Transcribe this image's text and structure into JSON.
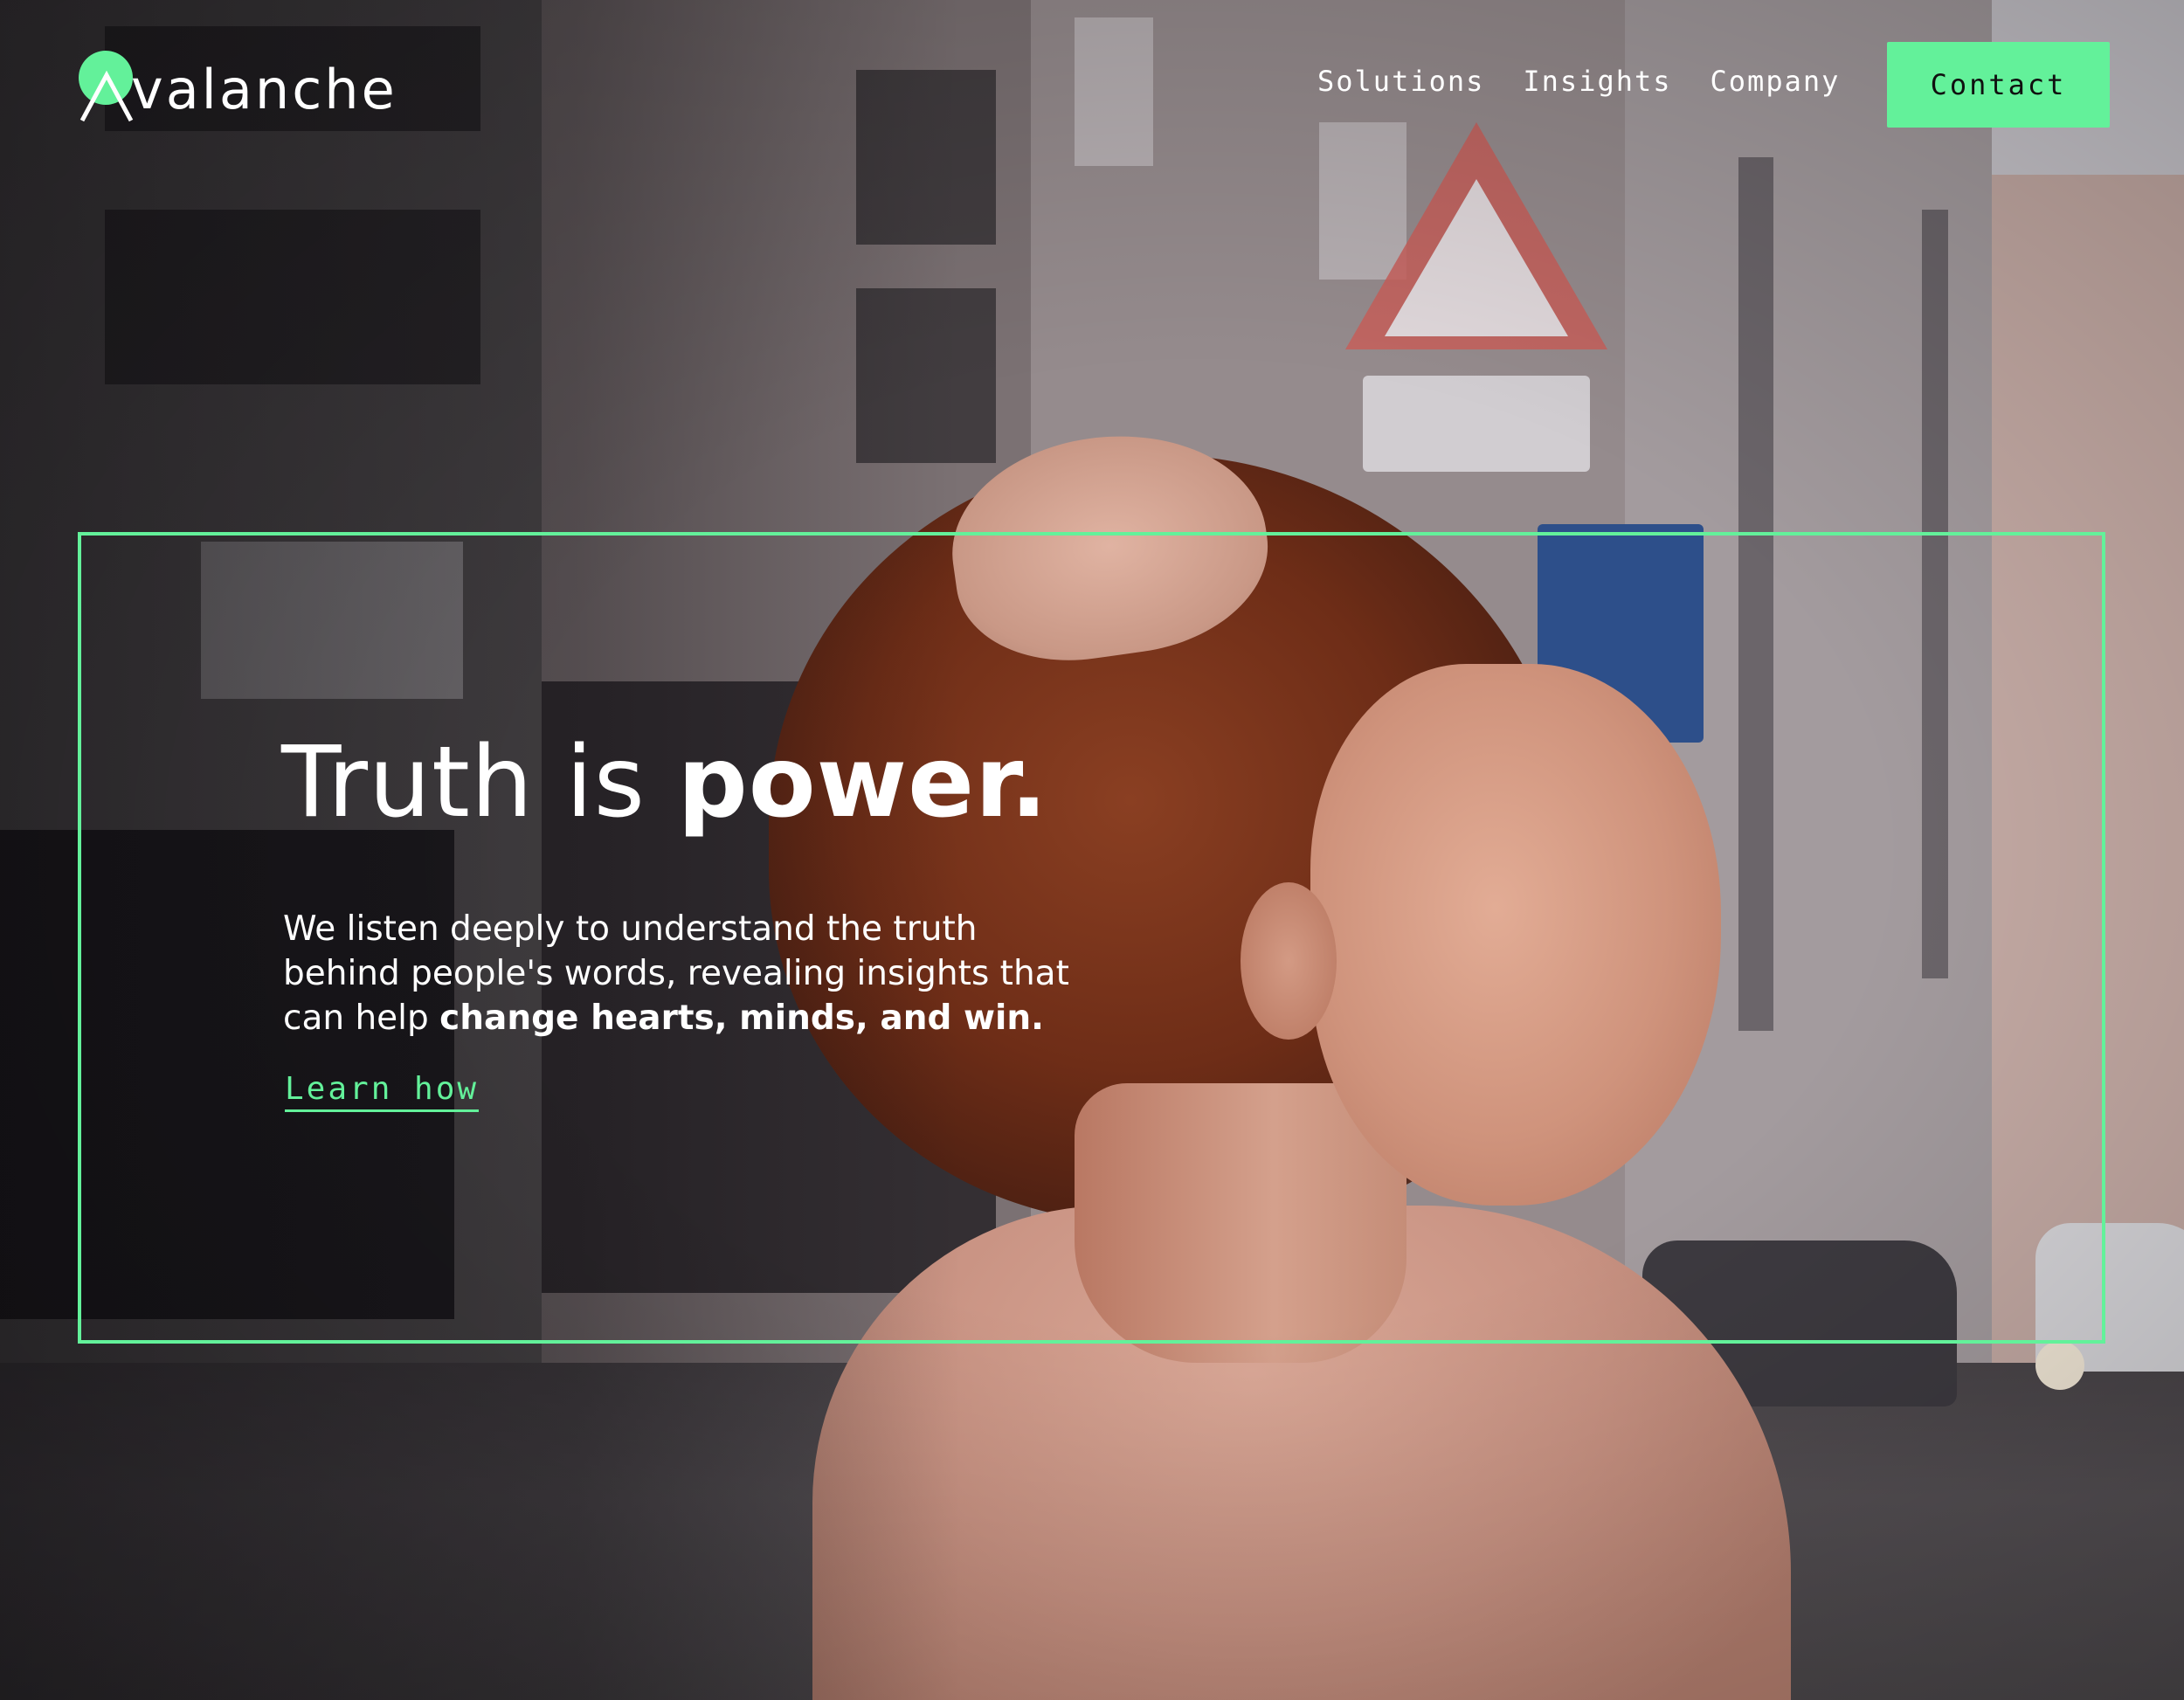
{
  "brand": {
    "name": "Avalanche",
    "accent_color": "#63f19a",
    "logo_icon": "avalanche-a-logo-icon"
  },
  "nav": {
    "items": [
      {
        "label": "Solutions"
      },
      {
        "label": "Insights"
      },
      {
        "label": "Company"
      }
    ],
    "contact_label": "Contact"
  },
  "hero": {
    "title_regular": "Truth is ",
    "title_bold": "power.",
    "description_regular": "We listen deeply to understand the truth behind people's words, revealing insights that can help ",
    "description_bold": "change hearts, minds, and win.",
    "cta_label": "Learn how",
    "background_image": "woman-with-red-hair-on-city-street-photo"
  }
}
